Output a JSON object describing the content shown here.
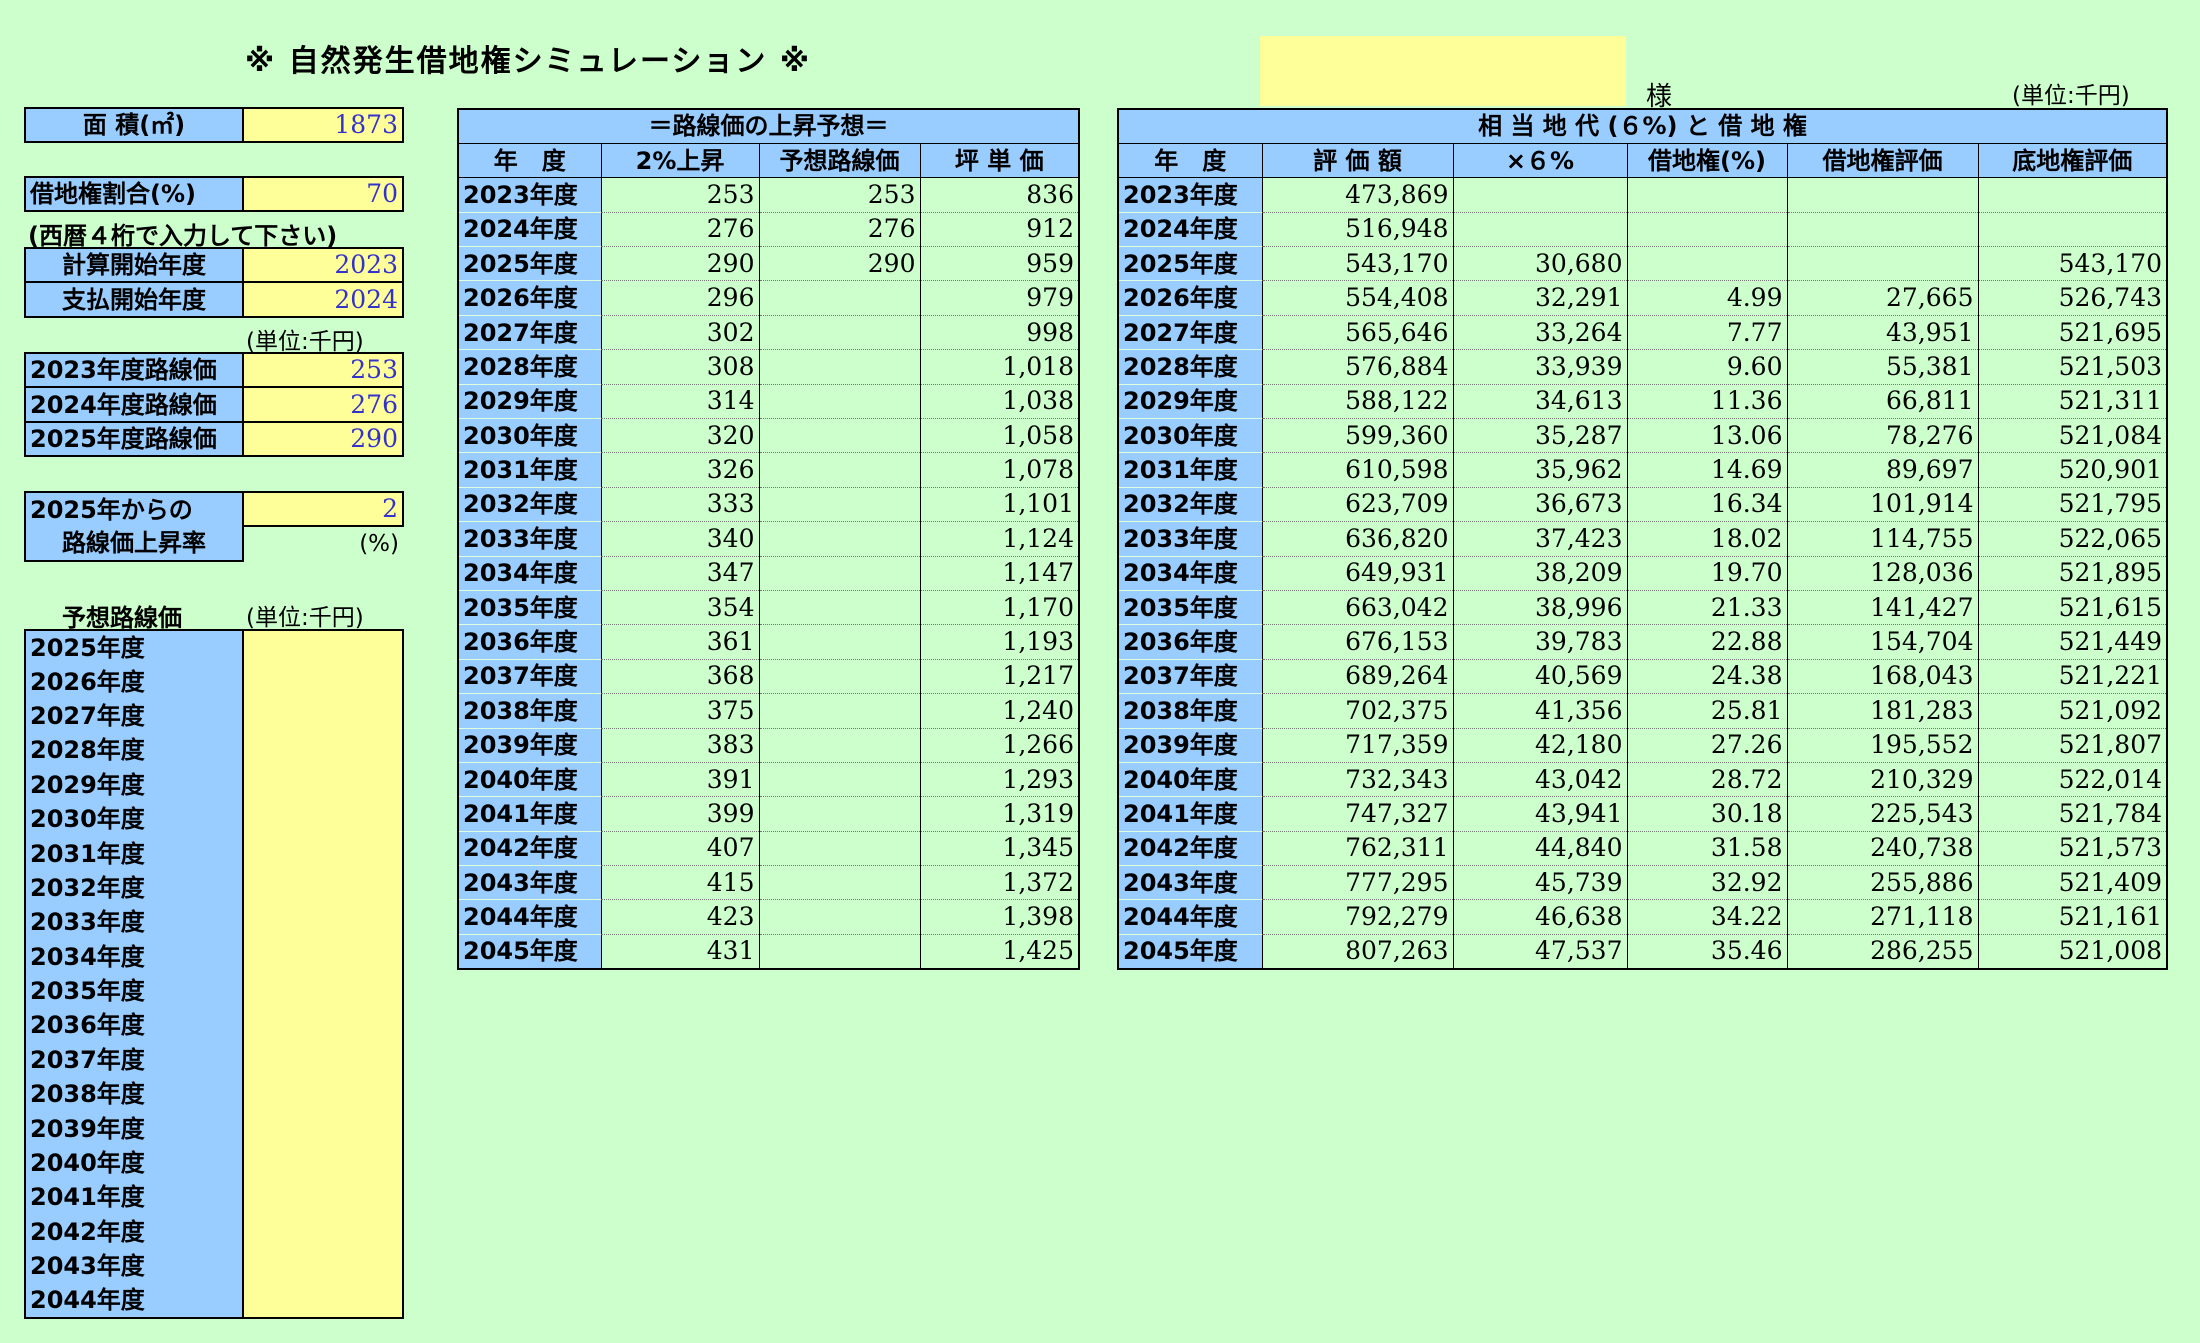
{
  "title": "※ 自然発生借地権シミュレーション ※",
  "client_suffix": "様",
  "unit_right": "(単位:千円)",
  "left": {
    "area_label": "面 積(㎡)",
    "area_value": "1873",
    "ratio_label": "借地権割合(%)",
    "ratio_value": "70",
    "note": "(西暦４桁で入力して下さい)",
    "calc_start_label": "計算開始年度",
    "calc_start_value": "2023",
    "pay_start_label": "支払開始年度",
    "pay_start_value": "2024",
    "unit": "(単位:千円)",
    "road_prices": [
      {
        "label": "2023年度路線価",
        "value": "253"
      },
      {
        "label": "2024年度路線価",
        "value": "276"
      },
      {
        "label": "2025年度路線価",
        "value": "290"
      }
    ],
    "rise_label_1": "2025年からの",
    "rise_label_2": "路線価上昇率",
    "rise_value": "2",
    "rise_unit": "(%)",
    "forecast_label": "予想路線価",
    "forecast_unit": "(単位:千円)",
    "forecast_years": [
      "2025年度",
      "2026年度",
      "2027年度",
      "2028年度",
      "2029年度",
      "2030年度",
      "2031年度",
      "2032年度",
      "2033年度",
      "2034年度",
      "2035年度",
      "2036年度",
      "2037年度",
      "2038年度",
      "2039年度",
      "2040年度",
      "2041年度",
      "2042年度",
      "2043年度",
      "2044年度"
    ]
  },
  "mid": {
    "title": "＝路線価の上昇予想＝",
    "headers": [
      "年　度",
      "2%上昇",
      "予想路線価",
      "坪 単 価"
    ],
    "rows": [
      [
        "2023年度",
        "253",
        "253",
        "836"
      ],
      [
        "2024年度",
        "276",
        "276",
        "912"
      ],
      [
        "2025年度",
        "290",
        "290",
        "959"
      ],
      [
        "2026年度",
        "296",
        "",
        "979"
      ],
      [
        "2027年度",
        "302",
        "",
        "998"
      ],
      [
        "2028年度",
        "308",
        "",
        "1,018"
      ],
      [
        "2029年度",
        "314",
        "",
        "1,038"
      ],
      [
        "2030年度",
        "320",
        "",
        "1,058"
      ],
      [
        "2031年度",
        "326",
        "",
        "1,078"
      ],
      [
        "2032年度",
        "333",
        "",
        "1,101"
      ],
      [
        "2033年度",
        "340",
        "",
        "1,124"
      ],
      [
        "2034年度",
        "347",
        "",
        "1,147"
      ],
      [
        "2035年度",
        "354",
        "",
        "1,170"
      ],
      [
        "2036年度",
        "361",
        "",
        "1,193"
      ],
      [
        "2037年度",
        "368",
        "",
        "1,217"
      ],
      [
        "2038年度",
        "375",
        "",
        "1,240"
      ],
      [
        "2039年度",
        "383",
        "",
        "1,266"
      ],
      [
        "2040年度",
        "391",
        "",
        "1,293"
      ],
      [
        "2041年度",
        "399",
        "",
        "1,319"
      ],
      [
        "2042年度",
        "407",
        "",
        "1,345"
      ],
      [
        "2043年度",
        "415",
        "",
        "1,372"
      ],
      [
        "2044年度",
        "423",
        "",
        "1,398"
      ],
      [
        "2045年度",
        "431",
        "",
        "1,425"
      ]
    ]
  },
  "right": {
    "title": "相 当 地 代 (６%) と 借 地 権",
    "headers": [
      "年　度",
      "評 価 額",
      "×６%",
      "借地権(%)",
      "借地権評価",
      "底地権評価"
    ],
    "rows": [
      [
        "2023年度",
        "473,869",
        "",
        "",
        "",
        ""
      ],
      [
        "2024年度",
        "516,948",
        "",
        "",
        "",
        ""
      ],
      [
        "2025年度",
        "543,170",
        "30,680",
        "",
        "",
        "543,170"
      ],
      [
        "2026年度",
        "554,408",
        "32,291",
        "4.99",
        "27,665",
        "526,743"
      ],
      [
        "2027年度",
        "565,646",
        "33,264",
        "7.77",
        "43,951",
        "521,695"
      ],
      [
        "2028年度",
        "576,884",
        "33,939",
        "9.60",
        "55,381",
        "521,503"
      ],
      [
        "2029年度",
        "588,122",
        "34,613",
        "11.36",
        "66,811",
        "521,311"
      ],
      [
        "2030年度",
        "599,360",
        "35,287",
        "13.06",
        "78,276",
        "521,084"
      ],
      [
        "2031年度",
        "610,598",
        "35,962",
        "14.69",
        "89,697",
        "520,901"
      ],
      [
        "2032年度",
        "623,709",
        "36,673",
        "16.34",
        "101,914",
        "521,795"
      ],
      [
        "2033年度",
        "636,820",
        "37,423",
        "18.02",
        "114,755",
        "522,065"
      ],
      [
        "2034年度",
        "649,931",
        "38,209",
        "19.70",
        "128,036",
        "521,895"
      ],
      [
        "2035年度",
        "663,042",
        "38,996",
        "21.33",
        "141,427",
        "521,615"
      ],
      [
        "2036年度",
        "676,153",
        "39,783",
        "22.88",
        "154,704",
        "521,449"
      ],
      [
        "2037年度",
        "689,264",
        "40,569",
        "24.38",
        "168,043",
        "521,221"
      ],
      [
        "2038年度",
        "702,375",
        "41,356",
        "25.81",
        "181,283",
        "521,092"
      ],
      [
        "2039年度",
        "717,359",
        "42,180",
        "27.26",
        "195,552",
        "521,807"
      ],
      [
        "2040年度",
        "732,343",
        "43,042",
        "28.72",
        "210,329",
        "522,014"
      ],
      [
        "2041年度",
        "747,327",
        "43,941",
        "30.18",
        "225,543",
        "521,784"
      ],
      [
        "2042年度",
        "762,311",
        "44,840",
        "31.58",
        "240,738",
        "521,573"
      ],
      [
        "2043年度",
        "777,295",
        "45,739",
        "32.92",
        "255,886",
        "521,409"
      ],
      [
        "2044年度",
        "792,279",
        "46,638",
        "34.22",
        "271,118",
        "521,161"
      ],
      [
        "2045年度",
        "807,263",
        "47,537",
        "35.46",
        "286,255",
        "521,008"
      ]
    ]
  }
}
